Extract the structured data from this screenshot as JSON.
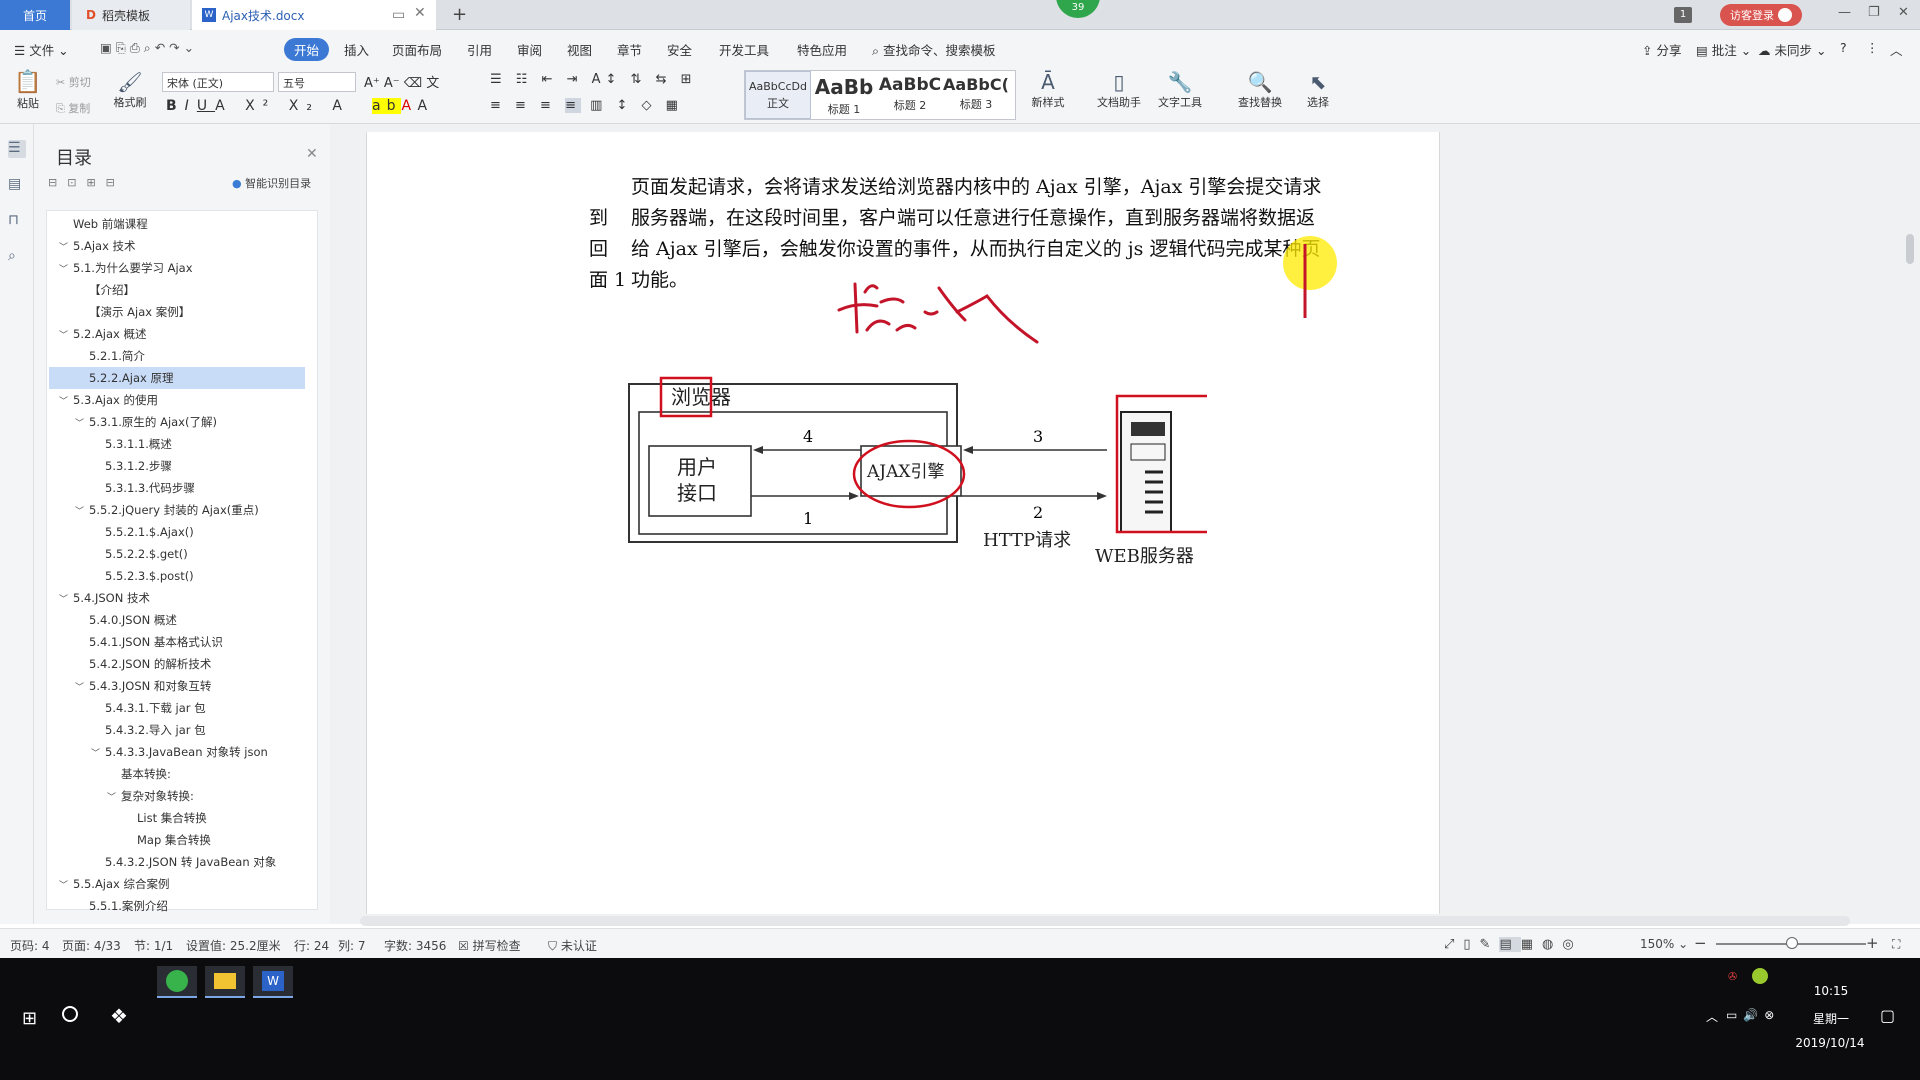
{
  "tabs": {
    "home": "首页",
    "templates": "稻壳模板",
    "document": "Ajax技术.docx"
  },
  "cloud_badge": "39",
  "window_count": "1",
  "visitor_login": "访客登录",
  "menu": {
    "file": "文件",
    "items": [
      "开始",
      "插入",
      "页面布局",
      "引用",
      "审阅",
      "视图",
      "章节",
      "安全",
      "开发工具",
      "特色应用"
    ],
    "search": "查找命令、搜索模板",
    "share": "分享",
    "comment": "批注",
    "sync": "未同步"
  },
  "ribbon": {
    "paste": "粘贴",
    "cut": "剪切",
    "copy": "复制",
    "format_painter": "格式刷",
    "font": "宋体 (正文)",
    "size": "五号",
    "styles": [
      {
        "preview": "AaBbCcDd",
        "label": "正文"
      },
      {
        "preview": "AaBb",
        "label": "标题 1"
      },
      {
        "preview": "AaBbC",
        "label": "标题 2"
      },
      {
        "preview": "AaBbC(",
        "label": "标题 3"
      }
    ],
    "new_style": "新样式",
    "doc_helper": "文档助手",
    "text_tool": "文字工具",
    "find_replace": "查找替换",
    "select": "选择"
  },
  "toc": {
    "title": "目录",
    "smart": "智能识别目录",
    "items": [
      {
        "text": "Web 前端课程",
        "level": 0,
        "caret": ""
      },
      {
        "text": "5.Ajax 技术",
        "level": 0,
        "caret": "v"
      },
      {
        "text": "5.1.为什么要学习 Ajax",
        "level": 1,
        "caret": "v"
      },
      {
        "text": "【介绍】",
        "level": 2,
        "caret": ""
      },
      {
        "text": "【演示 Ajax 案例】",
        "level": 2,
        "caret": ""
      },
      {
        "text": "5.2.Ajax 概述",
        "level": 1,
        "caret": "v"
      },
      {
        "text": "5.2.1.简介",
        "level": 2,
        "caret": ""
      },
      {
        "text": "5.2.2.Ajax 原理",
        "level": 2,
        "caret": "",
        "selected": true
      },
      {
        "text": "5.3.Ajax 的使用",
        "level": 1,
        "caret": "v"
      },
      {
        "text": "5.3.1.原生的 Ajax(了解)",
        "level": 2,
        "caret": "v"
      },
      {
        "text": "5.3.1.1.概述",
        "level": 3,
        "caret": ""
      },
      {
        "text": "5.3.1.2.步骤",
        "level": 3,
        "caret": ""
      },
      {
        "text": "5.3.1.3.代码步骤",
        "level": 3,
        "caret": ""
      },
      {
        "text": "5.5.2.jQuery 封装的 Ajax(重点)",
        "level": 2,
        "caret": "v"
      },
      {
        "text": "5.5.2.1.$.Ajax()",
        "level": 3,
        "caret": ""
      },
      {
        "text": "5.5.2.2.$.get()",
        "level": 3,
        "caret": ""
      },
      {
        "text": "5.5.2.3.$.post()",
        "level": 3,
        "caret": ""
      },
      {
        "text": "5.4.JSON 技术",
        "level": 1,
        "caret": "v"
      },
      {
        "text": "5.4.0.JSON 概述",
        "level": 2,
        "caret": ""
      },
      {
        "text": "5.4.1.JSON 基本格式认识",
        "level": 2,
        "caret": ""
      },
      {
        "text": "5.4.2.JSON 的解析技术",
        "level": 2,
        "caret": ""
      },
      {
        "text": "5.4.3.JOSN 和对象互转",
        "level": 2,
        "caret": "v"
      },
      {
        "text": "5.4.3.1.下载 jar 包",
        "level": 3,
        "caret": ""
      },
      {
        "text": "5.4.3.2.导入 jar 包",
        "level": 3,
        "caret": ""
      },
      {
        "text": "5.4.3.3.JavaBean 对象转 json",
        "level": 3,
        "caret": "v"
      },
      {
        "text": "基本转换:",
        "level": 4,
        "caret": ""
      },
      {
        "text": "复杂对象转换:",
        "level": 4,
        "caret": "v"
      },
      {
        "text": "List 集合转换",
        "level": 5,
        "caret": ""
      },
      {
        "text": "Map  集合转换",
        "level": 5,
        "caret": ""
      },
      {
        "text": "5.4.3.2.JSON 转 JavaBean 对象",
        "level": 3,
        "caret": ""
      },
      {
        "text": "5.5.Ajax 综合案例",
        "level": 1,
        "caret": "v"
      },
      {
        "text": "5.5.1.案例介绍",
        "level": 2,
        "caret": ""
      }
    ]
  },
  "document": {
    "lines": [
      {
        "indent": "",
        "text": "页面发起请求，会将请求发送给浏览器内核中的 Ajax 引擎，Ajax 引擎会提交请求"
      },
      {
        "indent": "到",
        "text": "服务器端，在这段时间里，客户端可以任意进行任意操作，直到服务器端将数据返"
      },
      {
        "indent": "回",
        "text": "给 Ajax 引擎后，会触发你设置的事件，从而执行自定义的 js 逻辑代码完成某种页"
      },
      {
        "indent": "面 1",
        "text": "功能。"
      }
    ],
    "diagram": {
      "browser": "浏览器",
      "user_line1": "用户",
      "user_line2": "接口",
      "engine": "AJAX引擎",
      "http": "HTTP请求",
      "server": "WEB服务器",
      "n1": "1",
      "n2": "2",
      "n3": "3",
      "n4": "4"
    }
  },
  "statusbar": {
    "page_no": "页码: 4",
    "page": "页面: 4/33",
    "section": "节: 1/1",
    "setting": "设置值: 25.2厘米",
    "row": "行: 24",
    "col": "列: 7",
    "words": "字数: 3456",
    "spell": "拼写检查",
    "cert": "未认证",
    "zoom": "150%"
  },
  "clock": {
    "time": "10:15",
    "weekday": "星期一",
    "date": "2019/10/14"
  }
}
